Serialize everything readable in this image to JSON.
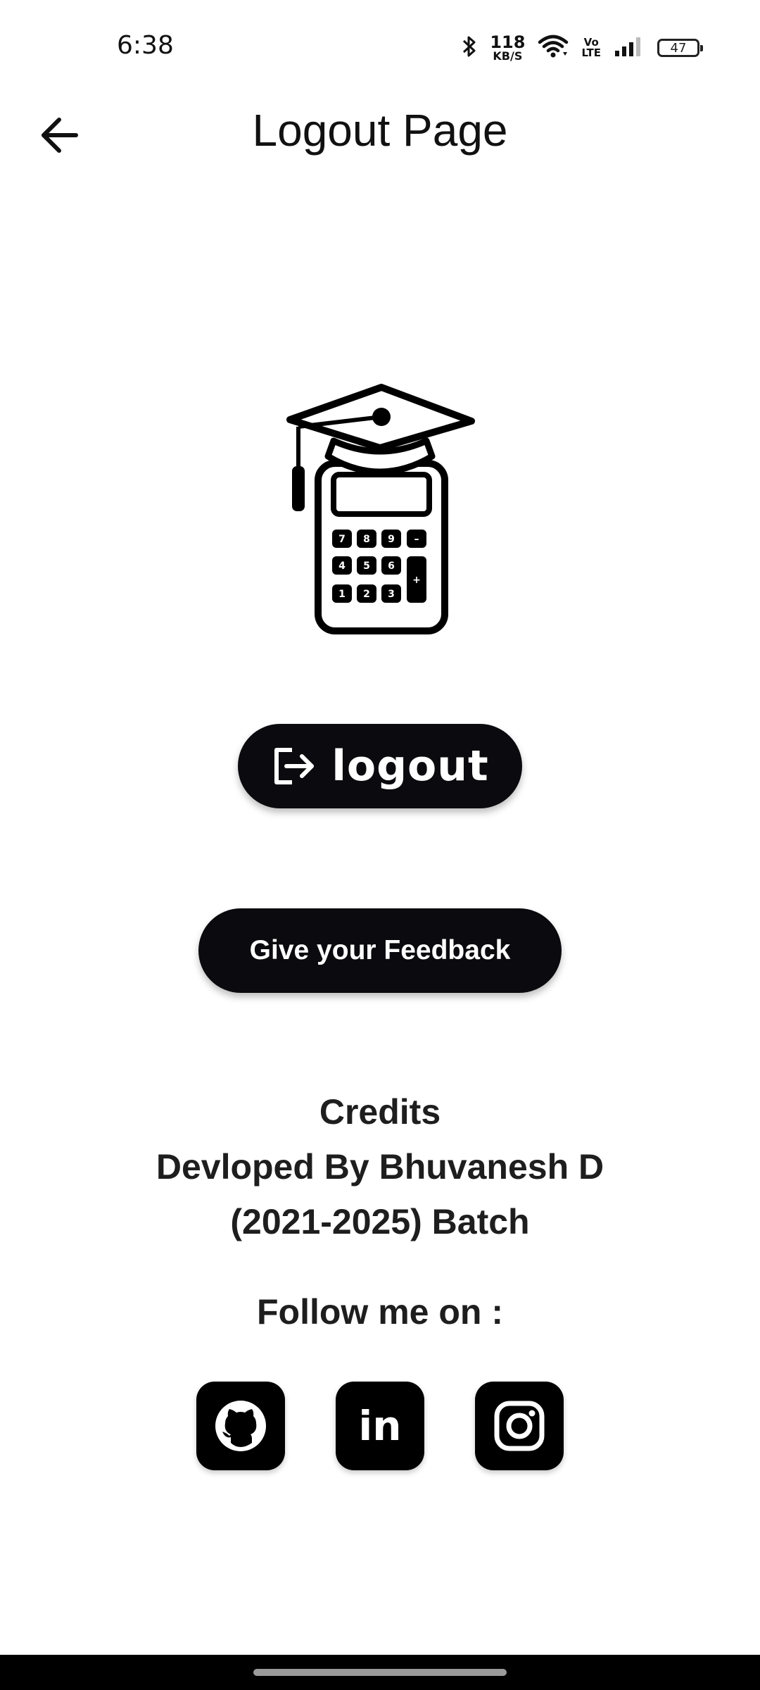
{
  "status_bar": {
    "time": "6:38",
    "net_speed_value": "118",
    "net_speed_unit": "KB/S",
    "volte_top": "Vo",
    "volte_bottom": "LTE",
    "battery": "47",
    "icons": [
      "bluetooth-icon",
      "wifi-icon",
      "volte-icon",
      "signal-icon",
      "battery-icon"
    ]
  },
  "app_bar": {
    "title": "Logout Page",
    "back_icon": "arrow-left-icon"
  },
  "logo": {
    "icon": "calculator-graduation-cap-logo",
    "keys": [
      "7",
      "8",
      "9",
      "–",
      "4",
      "5",
      "6",
      "+",
      "1",
      "2",
      "3"
    ]
  },
  "buttons": {
    "logout_label": "logout",
    "logout_icon": "logout-icon",
    "feedback_label": "Give your Feedback"
  },
  "credits": {
    "heading": "Credits",
    "line1": "Devloped By Bhuvanesh D",
    "line2": "(2021-2025) Batch"
  },
  "follow": {
    "label": "Follow me on :",
    "socials": [
      {
        "name": "GitHub",
        "icon": "github-icon"
      },
      {
        "name": "LinkedIn",
        "icon": "linkedin-icon",
        "glyph": "in"
      },
      {
        "name": "Instagram",
        "icon": "instagram-icon"
      }
    ]
  },
  "colors": {
    "button_bg": "#0b0b0f",
    "text": "#1e1e1e",
    "background": "#ffffff"
  }
}
